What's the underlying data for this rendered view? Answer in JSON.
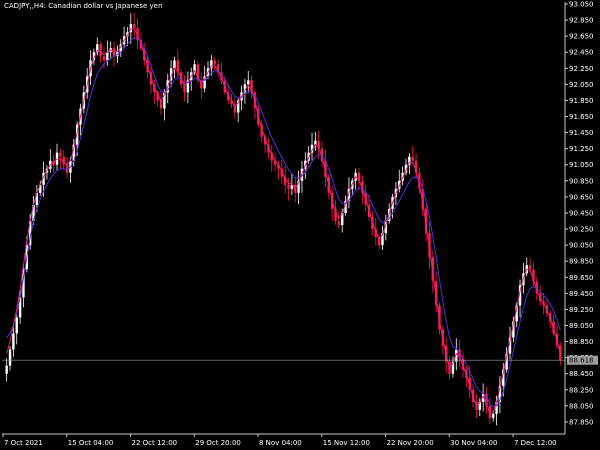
{
  "window": {
    "title": "CADJPY,,H4:  Canadian dollar vs Japanese yen"
  },
  "colors": {
    "background": "#000000",
    "axis": "#c8c8c8",
    "text": "#ffffff",
    "bull_candle": "#ffffff",
    "bear_candle": "#ff1a4b",
    "line_primary": "#e0257a",
    "line_secondary": "#5a2bd6",
    "bid_line": "#a0a0a0",
    "price_box_bg": "#a0a0a0",
    "price_box_text": "#000000"
  },
  "icons": {
    "chart_area": "candlestick-chart"
  },
  "chart_data": {
    "type": "candlestick",
    "title": "CADJPY,,H4:  Canadian dollar vs Japanese yen",
    "symbol": "CADJPY",
    "timeframe": "H4",
    "ylim": [
      87.7,
      93.05
    ],
    "grid": false,
    "y_ticks": [
      "93.050",
      "92.850",
      "92.650",
      "92.450",
      "92.250",
      "92.050",
      "91.850",
      "91.650",
      "91.450",
      "91.250",
      "91.050",
      "90.850",
      "90.650",
      "90.450",
      "90.250",
      "90.050",
      "89.850",
      "89.650",
      "89.450",
      "89.250",
      "89.050",
      "88.850",
      "88.650",
      "88.450",
      "88.250",
      "88.050",
      "87.850"
    ],
    "x_ticks": [
      "7 Oct 2021",
      "15 Oct 04:00",
      "22 Oct 12:00",
      "29 Oct 20:00",
      "8 Nov 04:00",
      "15 Nov 12:00",
      "22 Nov 20:00",
      "30 Nov 04:00",
      "7 Dec 12:00"
    ],
    "current_price": 88.618,
    "current_price_label": "88.618",
    "close_path": [
      88.55,
      88.75,
      88.95,
      89.15,
      89.4,
      89.75,
      90.05,
      90.35,
      90.55,
      90.7,
      90.8,
      90.95,
      91.0,
      91.1,
      91.05,
      91.2,
      91.15,
      91.05,
      90.95,
      91.1,
      91.3,
      91.55,
      91.75,
      91.95,
      92.15,
      92.35,
      92.45,
      92.55,
      92.4,
      92.35,
      92.45,
      92.5,
      92.4,
      92.45,
      92.55,
      92.65,
      92.7,
      92.8,
      92.75,
      92.6,
      92.5,
      92.35,
      92.2,
      92.05,
      91.95,
      91.85,
      91.75,
      91.95,
      92.1,
      92.25,
      92.35,
      92.2,
      92.05,
      91.95,
      92.1,
      92.2,
      92.3,
      92.1,
      92.0,
      92.15,
      92.25,
      92.35,
      92.3,
      92.2,
      92.1,
      91.95,
      91.85,
      91.8,
      91.7,
      91.85,
      91.95,
      92.05,
      92.1,
      91.95,
      91.75,
      91.55,
      91.4,
      91.3,
      91.2,
      91.1,
      91.05,
      91.0,
      90.9,
      90.8,
      90.75,
      90.8,
      90.7,
      90.85,
      91.0,
      91.1,
      91.2,
      91.3,
      91.35,
      91.25,
      91.1,
      90.9,
      90.7,
      90.5,
      90.35,
      90.3,
      90.45,
      90.6,
      90.75,
      90.85,
      90.95,
      90.85,
      90.7,
      90.55,
      90.4,
      90.25,
      90.15,
      90.05,
      90.2,
      90.35,
      90.5,
      90.65,
      90.75,
      90.85,
      90.95,
      91.05,
      91.15,
      91.1,
      90.95,
      90.75,
      90.5,
      90.2,
      89.9,
      89.6,
      89.3,
      89.0,
      88.8,
      88.6,
      88.45,
      88.6,
      88.75,
      88.65,
      88.5,
      88.4,
      88.25,
      88.1,
      88.0,
      88.1,
      88.2,
      88.05,
      87.9,
      87.95,
      88.1,
      88.3,
      88.5,
      88.7,
      88.9,
      89.1,
      89.3,
      89.55,
      89.7,
      89.8,
      89.75,
      89.6,
      89.45,
      89.35,
      89.3,
      89.2,
      89.1,
      88.95,
      88.8,
      88.62
    ],
    "ma_primary": [
      88.7,
      88.85,
      89.05,
      89.25,
      89.5,
      89.8,
      90.1,
      90.35,
      90.55,
      90.7,
      90.8,
      90.9,
      90.98,
      91.05,
      91.08,
      91.12,
      91.12,
      91.08,
      91.05,
      91.1,
      91.25,
      91.45,
      91.65,
      91.85,
      92.05,
      92.25,
      92.38,
      92.47,
      92.45,
      92.42,
      92.45,
      92.48,
      92.45,
      92.46,
      92.52,
      92.6,
      92.66,
      92.74,
      92.74,
      92.66,
      92.56,
      92.42,
      92.28,
      92.14,
      92.02,
      91.92,
      91.84,
      91.92,
      92.02,
      92.15,
      92.25,
      92.22,
      92.12,
      92.04,
      92.08,
      92.15,
      92.22,
      92.14,
      92.06,
      92.12,
      92.2,
      92.28,
      92.28,
      92.22,
      92.14,
      92.02,
      91.92,
      91.85,
      91.77,
      91.82,
      91.9,
      91.98,
      92.04,
      91.98,
      91.84,
      91.66,
      91.5,
      91.38,
      91.27,
      91.18,
      91.11,
      91.05,
      90.97,
      90.88,
      90.82,
      90.81,
      90.75,
      90.82,
      90.94,
      91.04,
      91.14,
      91.23,
      91.3,
      91.26,
      91.15,
      90.98,
      90.8,
      90.62,
      90.46,
      90.38,
      90.44,
      90.56,
      90.7,
      90.81,
      90.9,
      90.86,
      90.75,
      90.62,
      90.48,
      90.34,
      90.22,
      90.12,
      90.18,
      90.3,
      90.44,
      90.58,
      90.69,
      90.79,
      90.89,
      90.98,
      91.08,
      91.08,
      90.98,
      90.8,
      90.58,
      90.3,
      90.0,
      89.7,
      89.4,
      89.1,
      88.88,
      88.68,
      88.52,
      88.58,
      88.7,
      88.66,
      88.54,
      88.44,
      88.3,
      88.16,
      88.05,
      88.09,
      88.17,
      88.08,
      87.95,
      87.97,
      88.09,
      88.27,
      88.46,
      88.66,
      88.86,
      89.06,
      89.26,
      89.48,
      89.64,
      89.75,
      89.74,
      89.62,
      89.49,
      89.39,
      89.33,
      89.24,
      89.14,
      89.0,
      88.86,
      88.7
    ],
    "ma_secondary": [
      88.9,
      88.95,
      89.05,
      89.2,
      89.4,
      89.65,
      89.9,
      90.15,
      90.35,
      90.5,
      90.62,
      90.72,
      90.8,
      90.88,
      90.93,
      90.98,
      91.0,
      91.0,
      90.99,
      91.02,
      91.1,
      91.22,
      91.38,
      91.55,
      91.72,
      91.9,
      92.05,
      92.18,
      92.25,
      92.3,
      92.34,
      92.38,
      92.4,
      92.42,
      92.45,
      92.5,
      92.55,
      92.6,
      92.63,
      92.62,
      92.58,
      92.5,
      92.4,
      92.28,
      92.16,
      92.05,
      91.96,
      91.95,
      91.98,
      92.04,
      92.1,
      92.13,
      92.11,
      92.07,
      92.07,
      92.09,
      92.13,
      92.12,
      92.09,
      92.1,
      92.14,
      92.19,
      92.22,
      92.21,
      92.17,
      92.11,
      92.04,
      91.97,
      91.9,
      91.88,
      91.89,
      91.92,
      91.96,
      91.96,
      91.91,
      91.82,
      91.71,
      91.6,
      91.49,
      91.39,
      91.3,
      91.22,
      91.14,
      91.06,
      90.99,
      90.94,
      90.89,
      90.88,
      90.91,
      90.96,
      91.02,
      91.09,
      91.15,
      91.18,
      91.17,
      91.1,
      91.0,
      90.87,
      90.74,
      90.62,
      90.57,
      90.57,
      90.61,
      90.67,
      90.73,
      90.76,
      90.75,
      90.71,
      90.64,
      90.55,
      90.46,
      90.37,
      90.33,
      90.34,
      90.38,
      90.45,
      90.52,
      90.6,
      90.68,
      90.76,
      90.84,
      90.89,
      90.9,
      90.86,
      90.76,
      90.6,
      90.4,
      90.16,
      89.9,
      89.62,
      89.35,
      89.1,
      88.9,
      88.79,
      88.76,
      88.71,
      88.64,
      88.57,
      88.48,
      88.38,
      88.28,
      88.23,
      88.21,
      88.16,
      88.08,
      88.04,
      88.05,
      88.12,
      88.23,
      88.38,
      88.55,
      88.73,
      88.91,
      89.1,
      89.27,
      89.42,
      89.51,
      89.53,
      89.51,
      89.47,
      89.43,
      89.38,
      89.32,
      89.23,
      89.12,
      88.99
    ]
  }
}
